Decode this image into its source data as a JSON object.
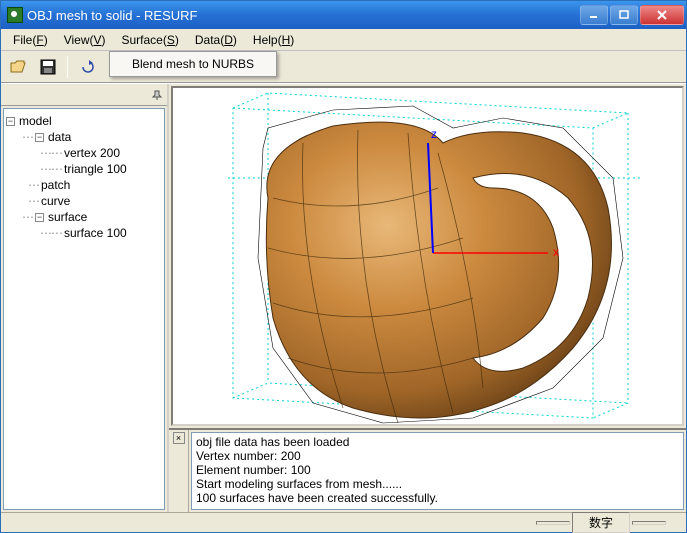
{
  "window": {
    "title": "OBJ mesh to solid - RESURF"
  },
  "menubar": {
    "items": [
      {
        "label": "File",
        "key": "F"
      },
      {
        "label": "View",
        "key": "V"
      },
      {
        "label": "Surface",
        "key": "S"
      },
      {
        "label": "Data",
        "key": "D"
      },
      {
        "label": "Help",
        "key": "H"
      }
    ],
    "dropdown": {
      "items": [
        "Blend mesh to NURBS"
      ]
    }
  },
  "tree": {
    "root": "model",
    "nodes": {
      "model": "model",
      "data": "data",
      "vertex": "vertex 200",
      "triangle": "triangle 100",
      "patch": "patch",
      "curve": "curve",
      "surface": "surface",
      "surface100": "surface 100"
    }
  },
  "axes": {
    "x": "x",
    "z": "z"
  },
  "log": [
    "obj file data has been loaded",
    "Vertex number: 200",
    "Element number: 100",
    "Start modeling surfaces from mesh......",
    "100 surfaces have been created successfully."
  ],
  "statusbar": {
    "label": "数字"
  }
}
